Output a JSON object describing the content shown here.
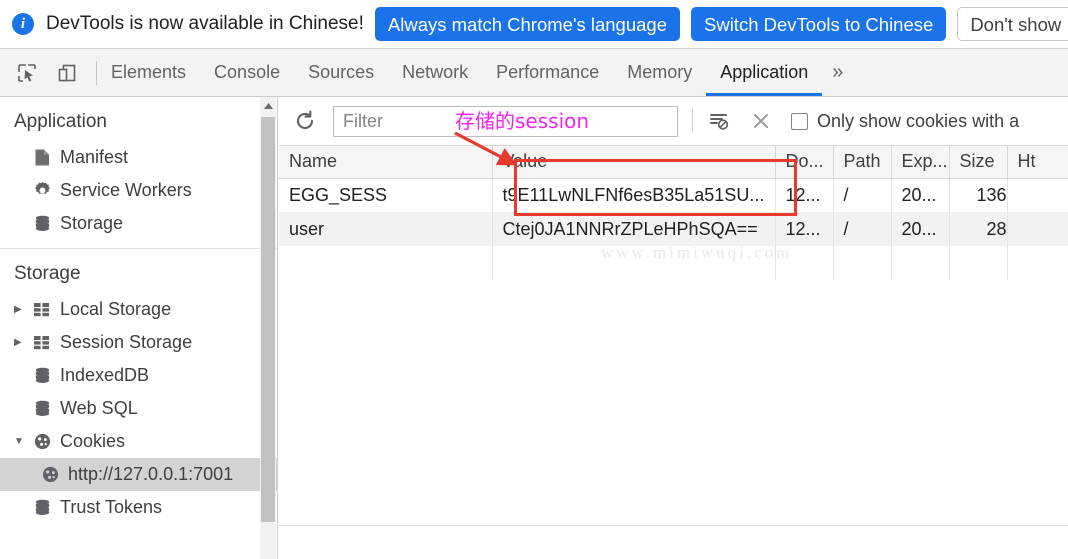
{
  "notice": {
    "icon": "info-icon",
    "message": "DevTools is now available in Chinese!",
    "buttons": [
      {
        "label": "Always match Chrome's language",
        "style": "primary"
      },
      {
        "label": "Switch DevTools to Chinese",
        "style": "primary"
      },
      {
        "label": "Don't show",
        "style": "secondary"
      }
    ]
  },
  "toolbar": {
    "inspect_icon": "inspect-element-icon",
    "device_icon": "device-toolbar-icon",
    "tabs": [
      {
        "label": "Elements",
        "active": false
      },
      {
        "label": "Console",
        "active": false
      },
      {
        "label": "Sources",
        "active": false
      },
      {
        "label": "Network",
        "active": false
      },
      {
        "label": "Performance",
        "active": false
      },
      {
        "label": "Memory",
        "active": false
      },
      {
        "label": "Application",
        "active": true
      }
    ],
    "more_label": "»",
    "active_tab_color": "#1a73e8"
  },
  "sidebar": {
    "sections": [
      {
        "title": "Application",
        "items": [
          {
            "label": "Manifest",
            "icon": "manifest-document-icon",
            "arrow": "",
            "indent": 1,
            "selected": false
          },
          {
            "label": "Service Workers",
            "icon": "gear-icon",
            "arrow": "",
            "indent": 1,
            "selected": false
          },
          {
            "label": "Storage",
            "icon": "database-icon",
            "arrow": "",
            "indent": 1,
            "selected": false
          }
        ]
      },
      {
        "title": "Storage",
        "items": [
          {
            "label": "Local Storage",
            "icon": "table-grid-icon",
            "arrow": "▶",
            "indent": 1,
            "selected": false
          },
          {
            "label": "Session Storage",
            "icon": "table-grid-icon",
            "arrow": "▶",
            "indent": 1,
            "selected": false
          },
          {
            "label": "IndexedDB",
            "icon": "database-icon",
            "arrow": "",
            "indent": 1,
            "selected": false
          },
          {
            "label": "Web SQL",
            "icon": "database-icon",
            "arrow": "",
            "indent": 1,
            "selected": false
          },
          {
            "label": "Cookies",
            "icon": "cookie-icon",
            "arrow": "▼",
            "indent": 1,
            "selected": false
          },
          {
            "label": "http://127.0.0.1:7001",
            "icon": "cookie-icon",
            "arrow": "",
            "indent": 2,
            "selected": true
          },
          {
            "label": "Trust Tokens",
            "icon": "database-icon",
            "arrow": "",
            "indent": 1,
            "selected": false
          }
        ]
      }
    ]
  },
  "filter_bar": {
    "refresh_icon": "refresh-icon",
    "filter_placeholder": "Filter",
    "filter_value": "",
    "clear_filter_icon": "clear-filter-icon",
    "close_icon": "close-x-icon",
    "checkbox_checked": false,
    "checkbox_label": "Only show cookies with a"
  },
  "table": {
    "columns": [
      {
        "key": "name",
        "label": "Name"
      },
      {
        "key": "value",
        "label": "Value"
      },
      {
        "key": "domain",
        "label": "Do..."
      },
      {
        "key": "path",
        "label": "Path"
      },
      {
        "key": "expires",
        "label": "Exp..."
      },
      {
        "key": "size",
        "label": "Size"
      },
      {
        "key": "httponly",
        "label": "Ht"
      }
    ],
    "rows": [
      {
        "name": "EGG_SESS",
        "value": "t9E11LwNLFNf6esB35La51SU...",
        "domain": "12...",
        "path": "/",
        "expires": "20...",
        "size": "136",
        "httponly": ""
      },
      {
        "name": "user",
        "value": "Ctej0JA1NNRrZPLeHPhSQA==",
        "domain": "12...",
        "path": "/",
        "expires": "20...",
        "size": "28",
        "httponly": ""
      }
    ]
  },
  "annotations": {
    "chinese_note": "存储的session",
    "chinese_note_color": "#f324f3",
    "highlight_rect_color": "#e8392e",
    "arrow_color": "#e8392e",
    "watermark": "www.mimiwuqi.com"
  }
}
